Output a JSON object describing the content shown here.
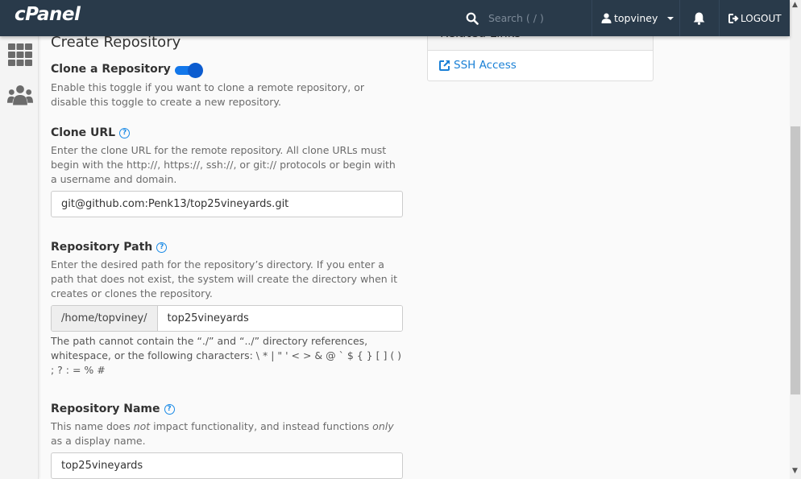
{
  "app": {
    "logo": "cPanel"
  },
  "topbar": {
    "search_placeholder": "Search ( / )",
    "username": "topviney",
    "logout_label": "LOGOUT"
  },
  "sidebar": {
    "items": [
      {
        "icon": "grid-icon",
        "label": "Tools"
      },
      {
        "icon": "users-icon",
        "label": "Users"
      }
    ]
  },
  "page": {
    "title": "Create Repository"
  },
  "form": {
    "clone_toggle": {
      "label": "Clone a Repository",
      "enabled": true,
      "description": "Enable this toggle if you want to clone a remote repository, or disable this toggle to create a new repository."
    },
    "clone_url": {
      "label": "Clone URL",
      "description": "Enter the clone URL for the remote repository. All clone URLs must begin with the http://, https://, ssh://, or git:// protocols or begin with a username and domain.",
      "value": "git@github.com:Penk13/top25vineyards.git"
    },
    "repository_path": {
      "label": "Repository Path",
      "description": "Enter the desired path for the repository’s directory. If you enter a path that does not exist, the system will create the directory when it creates or clones the repository.",
      "prefix": "/home/topviney/",
      "value": "top25vineyards",
      "note": "The path cannot contain the “./” and “../” directory references, whitespace, or the following characters: \\ * | \" ' < > & @ ` $ { } [ ] ( ) ; ? : = % #"
    },
    "repository_name": {
      "label": "Repository Name",
      "description_parts": [
        "This name does ",
        "not",
        " impact functionality, and instead functions ",
        "only",
        " as a display name."
      ],
      "value": "top25vineyards"
    }
  },
  "related_links": {
    "title": "Related Links",
    "links": [
      {
        "label": "SSH Access",
        "icon": "external-link-icon"
      }
    ]
  },
  "colors": {
    "topbar": "#293a4a",
    "accent": "#1377ea",
    "link": "#1a80d6"
  }
}
